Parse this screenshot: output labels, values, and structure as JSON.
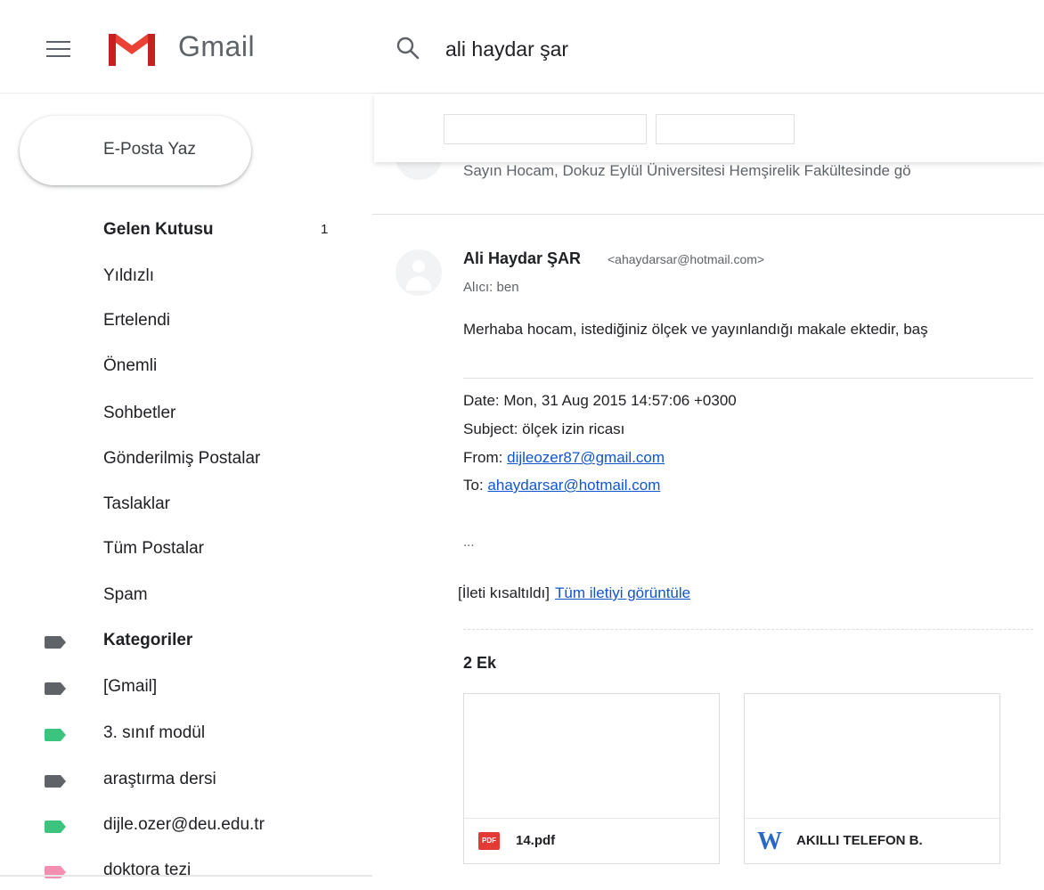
{
  "header": {
    "app_name": "Gmail",
    "search_value": "ali haydar şar"
  },
  "sidebar": {
    "compose_label": "E-Posta Yaz",
    "items": [
      {
        "label": "Gelen Kutusu",
        "count": "1"
      },
      {
        "label": "Yıldızlı"
      },
      {
        "label": "Ertelendi"
      },
      {
        "label": "Önemli"
      },
      {
        "label": "Sohbetler"
      },
      {
        "label": "Gönderilmiş Postalar"
      },
      {
        "label": "Taslaklar"
      },
      {
        "label": "Tüm Postalar"
      },
      {
        "label": "Spam"
      }
    ],
    "labels": [
      {
        "label": "Kategoriler",
        "color": "#5f6368"
      },
      {
        "label": "[Gmail]",
        "color": "#5f6368"
      },
      {
        "label": "3. sınıf modül",
        "color": "#3ac47d"
      },
      {
        "label": "araştırma dersi",
        "color": "#5f6368"
      },
      {
        "label": "dijle.ozer@deu.edu.tr",
        "color": "#3ac47d"
      },
      {
        "label": "doktora tezi",
        "color": "#f48fb1"
      }
    ]
  },
  "thread": {
    "previous_snippet": "Sayın Hocam, Dokuz Eylül Üniversitesi Hemşirelik Fakültesinde gö",
    "message": {
      "sender_name": "Ali Haydar ŞAR",
      "sender_email": "<ahaydarsar@hotmail.com>",
      "to_line": "Alıcı: ben",
      "body": "Merhaba hocam, istediğiniz ölçek ve yayınlandığı makale ektedir, baş",
      "quoted": {
        "date": "Date: Mon, 31 Aug 2015 14:57:06 +0300",
        "subject": "Subject: ölçek izin ricası",
        "from_label": "From: ",
        "from_email": "dijleozer87@gmail.com",
        "to_label": "To: ",
        "to_email": "ahaydarsar@hotmail.com"
      },
      "ellipsis": "...",
      "clipped_text": "[İleti kısaltıldı]",
      "view_full_link": "Tüm iletiyi görüntüle"
    },
    "attachments_title": "2 Ek",
    "attachments": [
      {
        "name": "14.pdf",
        "icon_label": "PDF",
        "icon": "pdf-icon"
      },
      {
        "name": "AKILLI TELEFON B.",
        "icon_label": "W",
        "icon": "word-icon"
      }
    ]
  },
  "colors": {
    "link": "#1155cc",
    "gmail_red": "#ea4335"
  }
}
